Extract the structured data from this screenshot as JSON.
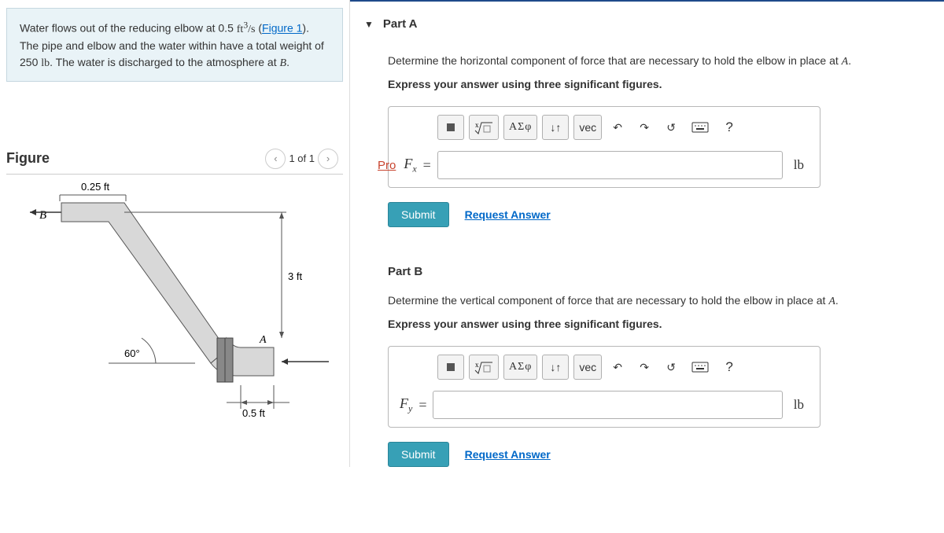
{
  "problem": {
    "text_1": "Water flows out of the reducing elbow at 0.5 ",
    "rate_value": "ft",
    "rate_exp": "3",
    "rate_unit_tail": "/s",
    "text_2": " (",
    "figure_link": "Figure 1",
    "text_3": "). The pipe and elbow and the water within have a total weight of 250 ",
    "weight_unit": "lb",
    "text_4": ". The water is discharged to the atmosphere at ",
    "point_b": "B",
    "text_5": "."
  },
  "figure": {
    "title": "Figure",
    "counter": "1 of 1",
    "dims": {
      "d025": "0.25 ft",
      "d3": "3 ft",
      "d05": "0.5 ft",
      "ang": "60°",
      "ptA": "A",
      "ptB": "B"
    }
  },
  "partA": {
    "title": "Part A",
    "prompt_1": "Determine the horizontal component of force that are necessary to hold the elbow in place at ",
    "prompt_A": "A",
    "prompt_2": ".",
    "instruction": "Express your answer using three significant figures.",
    "pro": "Pro",
    "var": "F",
    "sub": "x",
    "eq": " = ",
    "unit": "lb",
    "submit": "Submit",
    "request": "Request Answer",
    "toolbar": {
      "greek": "ΑΣφ",
      "vec": "vec",
      "help": "?"
    }
  },
  "partB": {
    "title": "Part B",
    "prompt_1": "Determine the vertical component of force that are necessary to hold the elbow in place at ",
    "prompt_A": "A",
    "prompt_2": ".",
    "instruction": "Express your answer using three significant figures.",
    "var": "F",
    "sub": "y",
    "eq": " = ",
    "unit": "lb",
    "submit": "Submit",
    "request": "Request Answer",
    "toolbar": {
      "greek": "ΑΣφ",
      "vec": "vec",
      "help": "?"
    }
  }
}
